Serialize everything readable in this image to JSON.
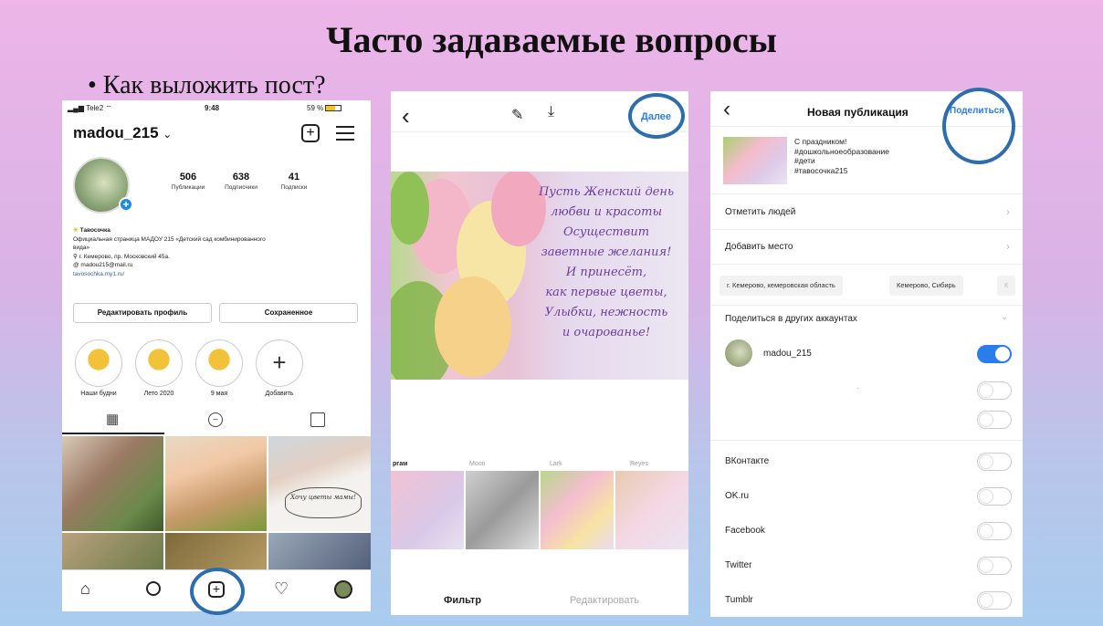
{
  "slide": {
    "title": "Часто задаваемые вопросы",
    "bullet": "• Как выложить пост?"
  },
  "profile_screen": {
    "status": {
      "carrier": "Tele2",
      "time": "9:48",
      "battery": "59 %"
    },
    "username": "madou_215",
    "username_chevron": "⌄",
    "stats": [
      {
        "value": "506",
        "label": "Публикации"
      },
      {
        "value": "638",
        "label": "Подписчики"
      },
      {
        "value": "41",
        "label": "Подписки"
      }
    ],
    "bio": {
      "name": "Тавосочка",
      "line1": "Официальная страница МАДОУ 215 «Детский сад комбинированного",
      "line2": "вида»",
      "address": "г. Кемерово, пр. Московский 45а.",
      "email": "madou215@mail.ru",
      "link": "tavosochka.my1.ru/"
    },
    "buttons": {
      "edit": "Редактировать профиль",
      "saved": "Сохраненное"
    },
    "highlights": [
      {
        "label": "Наши будни"
      },
      {
        "label": "Лето 2020"
      },
      {
        "label": "9 мая"
      },
      {
        "label": "Добавить"
      }
    ],
    "grid_text": "Хочу цветы мамы!"
  },
  "filter_screen": {
    "header": {
      "back": "‹",
      "next_label": "Далее"
    },
    "post_text": [
      "Пусть Женский день",
      "любви и красоты",
      "Осуществит",
      "заветные желания!",
      "И принесёт,",
      "как первые цветы,",
      "Улыбки, нежность",
      "и очарованье!"
    ],
    "filter_names": [
      "ргам",
      "Moon",
      "Lark",
      "Reyes"
    ],
    "bottom_tabs": {
      "filter": "Фильтр",
      "edit": "Редактировать"
    }
  },
  "publish_screen": {
    "header": {
      "back": "‹",
      "title": "Новая публикация",
      "share_label": "Поделиться"
    },
    "caption": [
      "С праздником!",
      "#дошкольноеобразование",
      "#дети",
      "#тавосочка215"
    ],
    "tag_people": "Отметить людей",
    "add_location": "Добавить место",
    "location_suggestions": [
      "г. Кемерово, кемеровская область",
      "Кемерово, Сибирь",
      "К"
    ],
    "share_other": "Поделиться в других аккаунтах",
    "accounts": [
      {
        "name": "madou_215",
        "on": true
      }
    ],
    "services": [
      "ВКонтакте",
      "OK.ru",
      "Facebook",
      "Twitter",
      "Tumblr"
    ],
    "extra_dot": "·"
  },
  "icons": [
    "back-icon",
    "magic-wand-icon",
    "download-icon",
    "plus-square-icon",
    "menu-icon",
    "home-icon",
    "search-icon",
    "heart-icon",
    "grid-icon",
    "tag-icon"
  ],
  "colors": {
    "accent_blue": "#2e6dab",
    "toggle_blue": "#2b7ded",
    "link_blue": "#3a5ea8"
  }
}
